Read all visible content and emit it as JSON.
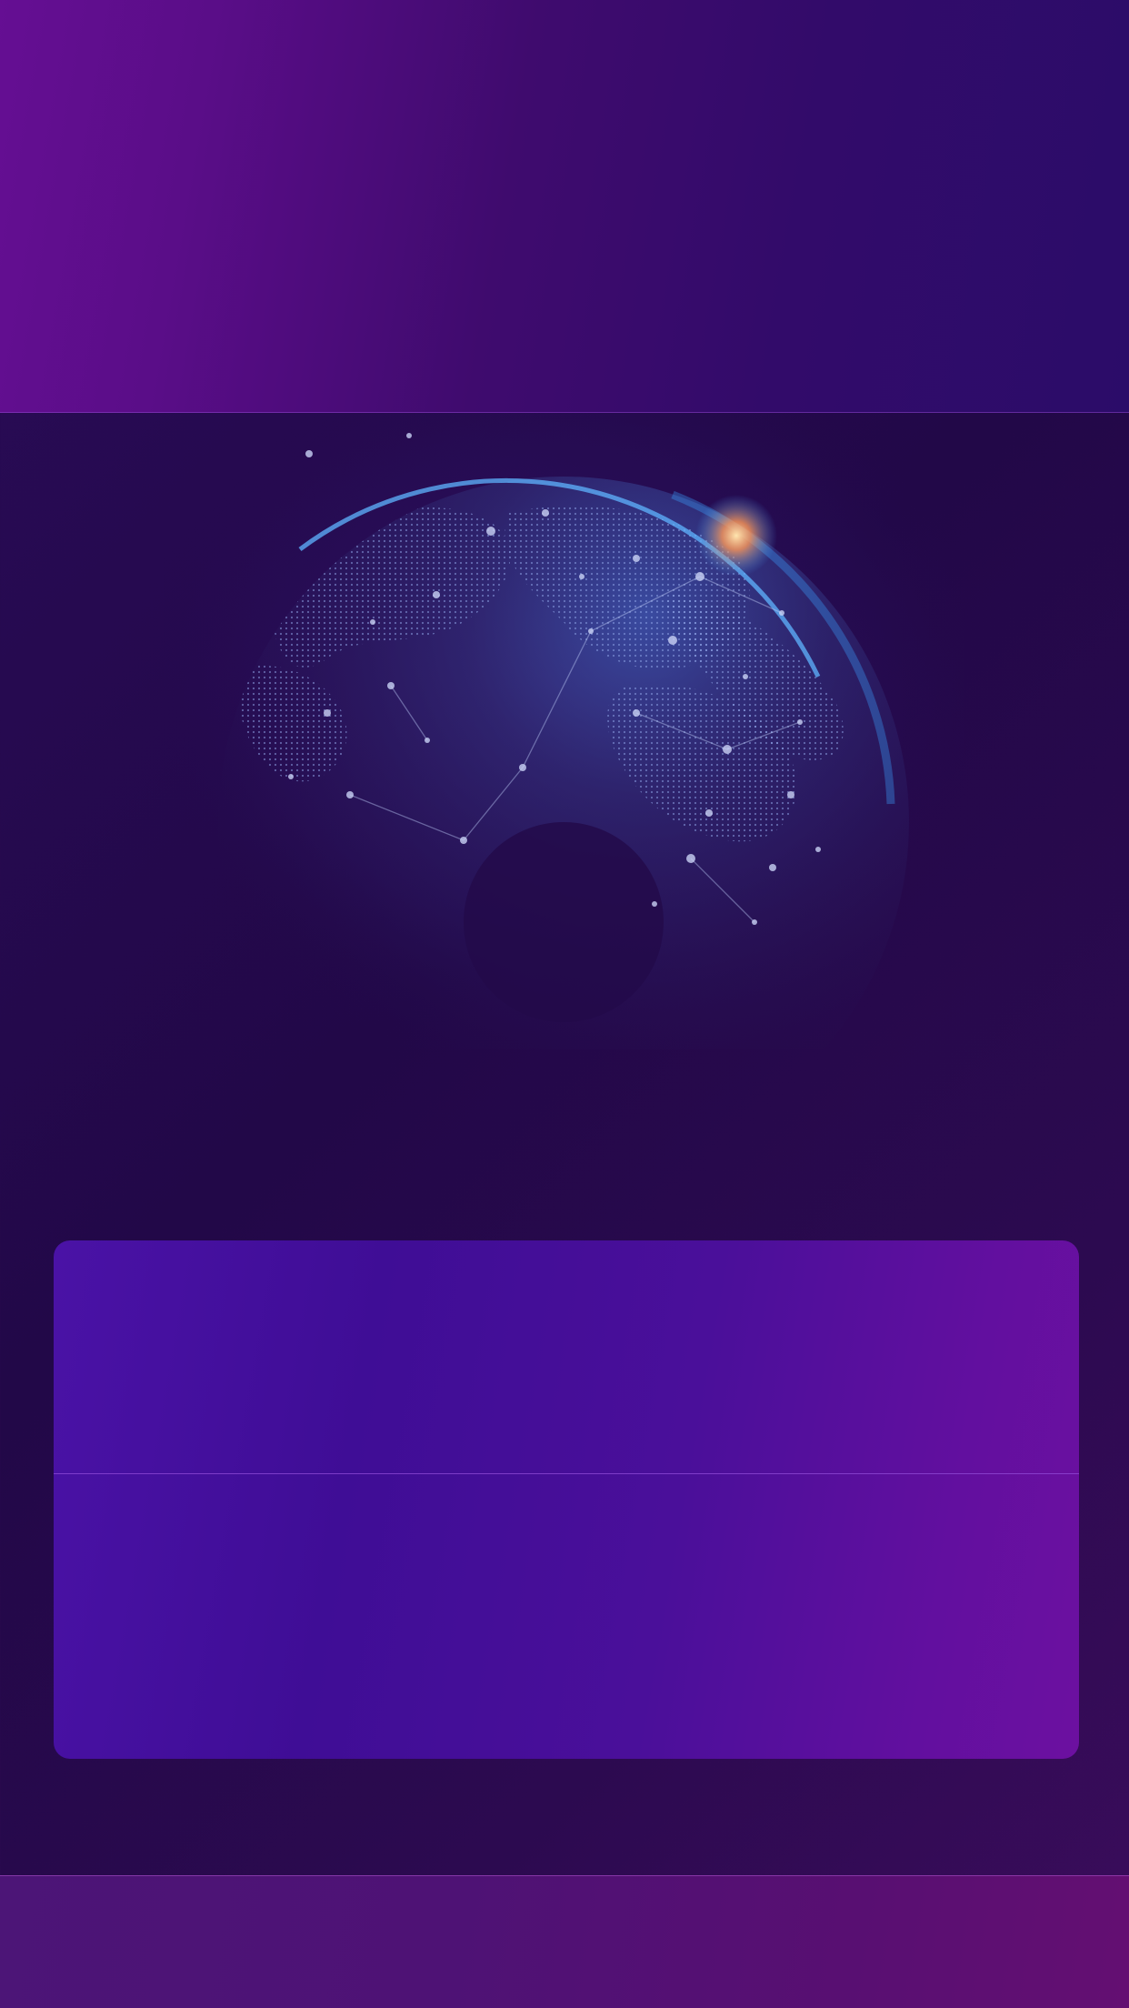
{
  "header": {
    "title": ""
  },
  "card": {
    "rows": [
      {
        "label": ""
      },
      {
        "label": ""
      }
    ]
  },
  "footer": {
    "label": ""
  },
  "colors": {
    "header_left": "#650e93",
    "header_right": "#2b0c69",
    "background": "#220848",
    "card_left": "#4a12a6",
    "card_right": "#6c10a0",
    "footer": "#580f72",
    "globe_glow": "#3aa0ff"
  },
  "icons": [
    "globe-illustration"
  ]
}
